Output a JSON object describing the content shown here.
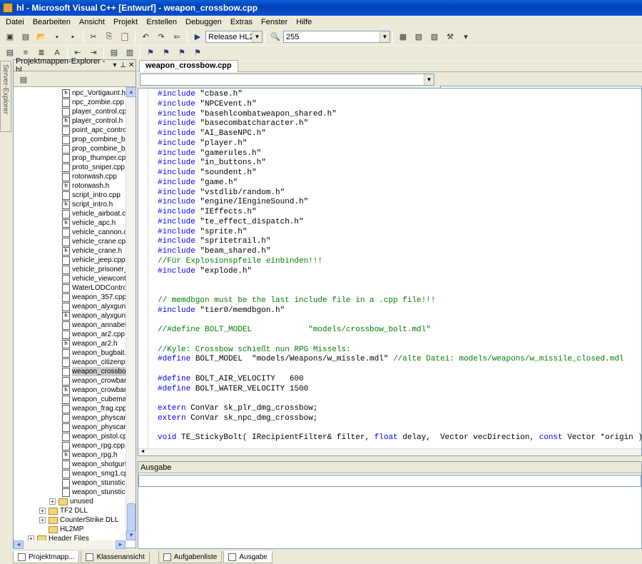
{
  "window": {
    "title": "hl - Microsoft Visual C++ [Entwurf] - weapon_crossbow.cpp"
  },
  "menu": [
    "Datei",
    "Bearbeiten",
    "Ansicht",
    "Projekt",
    "Erstellen",
    "Debuggen",
    "Extras",
    "Fenster",
    "Hilfe"
  ],
  "toolbar": {
    "config": "Release HL2",
    "search_value": "255"
  },
  "solution_explorer": {
    "title": "Projektmappen-Explorer - hl",
    "files": [
      "npc_Vortigaunt.h",
      "npc_zombie.cpp",
      "player_control.cpp",
      "player_control.h",
      "point_apc_controll",
      "prop_combine_ball",
      "prop_combine_ball",
      "prop_thumper.cpp",
      "proto_sniper.cpp",
      "rotorwash.cpp",
      "rotorwash.h",
      "script_intro.cpp",
      "script_intro.h",
      "vehicle_airboat.cp",
      "vehicle_apc.h",
      "vehicle_cannon.cp",
      "vehicle_crane.cpp",
      "vehicle_crane.h",
      "vehicle_jeep.cpp",
      "vehicle_prisoner_p",
      "vehicle_viewcontro",
      "WaterLODControl.",
      "weapon_357.cpp",
      "weapon_alyxgun.c",
      "weapon_alyxgun.h",
      "weapon_annabelle",
      "weapon_ar2.cpp",
      "weapon_ar2.h",
      "weapon_bugbait.c",
      "weapon_citizenpac",
      "weapon_crossbow",
      "weapon_crowbar.c",
      "weapon_crowbar.h",
      "weapon_cubemap",
      "weapon_frag.cpp",
      "weapon_physcann",
      "weapon_physcann",
      "weapon_pistol.cpp",
      "weapon_rpg.cpp",
      "weapon_rpg.h",
      "weapon_shotgun.c",
      "weapon_smg1.cpp",
      "weapon_stunstick.",
      "weapon_stunstick."
    ],
    "folders": [
      "unused",
      "TF2 DLL",
      "CounterStrike DLL",
      "HL2MP",
      "Header Files"
    ]
  },
  "server_explorer": "Server-Explorer",
  "editor": {
    "tab": "weapon_crossbow.cpp",
    "lines": [
      {
        "k": "#include",
        "r": " \"cbase.h\""
      },
      {
        "k": "#include",
        "r": " \"NPCEvent.h\""
      },
      {
        "k": "#include",
        "r": " \"basehlcombatweapon_shared.h\""
      },
      {
        "k": "#include",
        "r": " \"basecombatcharacter.h\""
      },
      {
        "k": "#include",
        "r": " \"AI_BaseNPC.h\""
      },
      {
        "k": "#include",
        "r": " \"player.h\""
      },
      {
        "k": "#include",
        "r": " \"gamerules.h\""
      },
      {
        "k": "#include",
        "r": " \"in_buttons.h\""
      },
      {
        "k": "#include",
        "r": " \"soundent.h\""
      },
      {
        "k": "#include",
        "r": " \"game.h\""
      },
      {
        "k": "#include",
        "r": " \"vstdlib/random.h\""
      },
      {
        "k": "#include",
        "r": " \"engine/IEngineSound.h\""
      },
      {
        "k": "#include",
        "r": " \"IEffects.h\""
      },
      {
        "k": "#include",
        "r": " \"te_effect_dispatch.h\""
      },
      {
        "k": "#include",
        "r": " \"sprite.h\""
      },
      {
        "k": "#include",
        "r": " \"spritetrail.h\""
      },
      {
        "k": "#include",
        "r": " \"beam_shared.h\""
      },
      {
        "c": "//Für Explosionspfeile einbinden!!!"
      },
      {
        "k": "#include",
        "r": " \"explode.h\""
      },
      {},
      {},
      {
        "c": "// memdbgon must be the last include file in a .cpp file!!!"
      },
      {
        "k": "#include",
        "r": " \"tier0/memdbgon.h\""
      },
      {},
      {
        "c": "//#define BOLT_MODEL            \"models/crossbow_bolt.mdl\""
      },
      {},
      {
        "c": "//Kyle: Crossbow schießt nun RPG Missels:"
      },
      {
        "k": "#define",
        "r": " BOLT_MODEL  \"models/Weapons/w_missle.mdl\" ",
        "c2": "//alte Datei: models/weapons/w_missile_closed.mdl"
      },
      {},
      {
        "k": "#define",
        "r": " BOLT_AIR_VELOCITY   600"
      },
      {
        "k": "#define",
        "r": " BOLT_WATER_VELOCITY 1500"
      },
      {},
      {
        "k": "extern",
        "r": " ConVar sk_plr_dmg_crossbow;"
      },
      {
        "k": "extern",
        "r": " ConVar sk_npc_dmg_crossbow;"
      },
      {},
      {
        "k": "void",
        "r": " TE_StickyBolt( IRecipientFilter& filter, ",
        "k2": "float",
        "r2": " delay,  Vector vecDirection, ",
        "k3": "const",
        "r3": " Vector *origin );"
      }
    ]
  },
  "output": {
    "title": "Ausgabe"
  },
  "bottom_tabs": [
    "Projektmapp...",
    "Klassenansicht",
    "Aufgabenliste",
    "Ausgabe"
  ]
}
